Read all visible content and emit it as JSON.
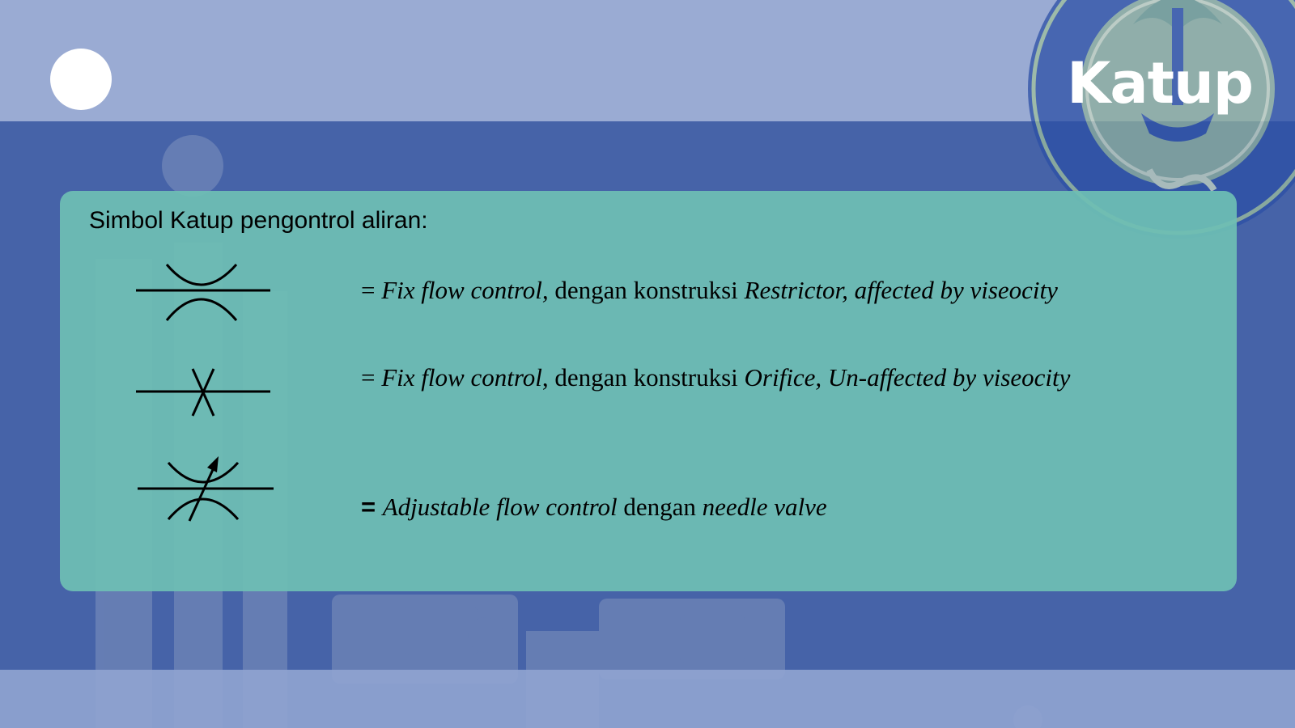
{
  "slide": {
    "title": "Katup"
  },
  "panel": {
    "heading": "Simbol Katup pengontrol aliran:",
    "rows": [
      {
        "symbol": "restrictor-symbol",
        "eq": "= ",
        "t1": "Fix flow control,",
        "t2": " dengan konstruksi ",
        "t3": "Restrictor, affected by viseocity"
      },
      {
        "symbol": "orifice-symbol",
        "eq": "= ",
        "t1": "Fix flow control",
        "t2": ", dengan konstruksi ",
        "t3": "Orifice, Un-affected by viseocity"
      },
      {
        "symbol": "adjustable-restrictor-symbol",
        "eq": "= ",
        "t1": "Adjustable flow control",
        "t2": " dengan ",
        "t3": "needle valve"
      }
    ]
  },
  "colors": {
    "background": "#4663a8",
    "top_band": "#9aabd3",
    "panel": "#6ebeb4",
    "title_text": "#ffffff"
  }
}
